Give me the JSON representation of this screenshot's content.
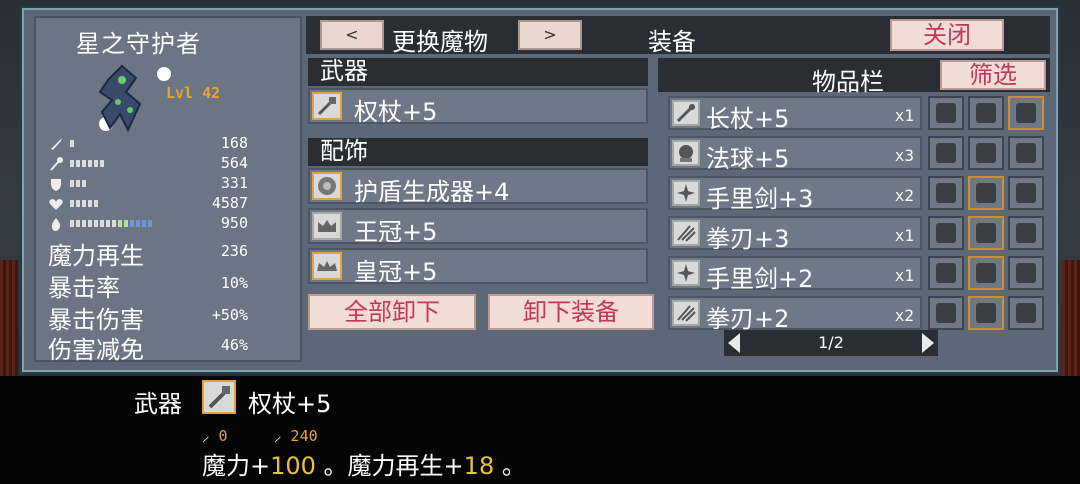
{
  "character": {
    "name": "星之守护者",
    "level": "Lvl 42",
    "stats": [
      {
        "icon": "sword-icon",
        "value": "168",
        "bar_segments": 1
      },
      {
        "icon": "staff-icon",
        "value": "564",
        "bar_segments": 6
      },
      {
        "icon": "shield-icon",
        "value": "331",
        "bar_segments": 3
      },
      {
        "icon": "heart-icon",
        "value": "4587",
        "bar_segments": 5
      },
      {
        "icon": "mana-icon",
        "value": "950",
        "bar_segments": 14
      }
    ],
    "attributes": [
      {
        "label": "魔力再生",
        "value": "236"
      },
      {
        "label": "暴击率",
        "value": "10%"
      },
      {
        "label": "暴击伤害",
        "value": "+50%"
      },
      {
        "label": "伤害减免",
        "value": "46%"
      }
    ]
  },
  "header": {
    "prev_label": "<",
    "change_monster_label": "更换魔物",
    "next_label": ">",
    "title": "装备",
    "close_label": "关闭"
  },
  "equipment": {
    "weapon_heading": "武器",
    "weapon": {
      "name": "权杖+5",
      "icon": "scepter-icon"
    },
    "accessory_heading": "配饰",
    "accessories": [
      {
        "name": "护盾生成器+4",
        "icon": "shield-generator-icon"
      },
      {
        "name": "王冠+5",
        "icon": "crown-icon"
      },
      {
        "name": "皇冠+5",
        "icon": "tiara-icon"
      }
    ],
    "unequip_all_label": "全部卸下",
    "unequip_label": "卸下装备"
  },
  "inventory": {
    "title": "物品栏",
    "filter_label": "筛选",
    "items": [
      {
        "name": "长杖+5",
        "qty": "x1",
        "icon": "long-staff-icon"
      },
      {
        "name": "法球+5",
        "qty": "x3",
        "icon": "orb-icon"
      },
      {
        "name": "手里剑+3",
        "qty": "x2",
        "icon": "shuriken-icon"
      },
      {
        "name": "拳刃+3",
        "qty": "x1",
        "icon": "claw-icon"
      },
      {
        "name": "手里剑+2",
        "qty": "x1",
        "icon": "shuriken-icon"
      },
      {
        "name": "拳刃+2",
        "qty": "x2",
        "icon": "claw-icon"
      }
    ],
    "page": "1/2"
  },
  "tooltip": {
    "kind": "武器",
    "name": "权杖+5",
    "stat_attack": "0",
    "stat_magic": "240",
    "desc_prefix": "魔力+",
    "desc_value1": "100",
    "desc_mid": " 。魔力再生+",
    "desc_value2": "18",
    "desc_suffix": " 。"
  },
  "colors": {
    "accent_gold": "#e8a62a",
    "button_pink_text": "#c0395a",
    "button_pink_bg": "#f2dcd6",
    "panel_bg": "#5c6878",
    "header_dark": "#2a2e34"
  }
}
